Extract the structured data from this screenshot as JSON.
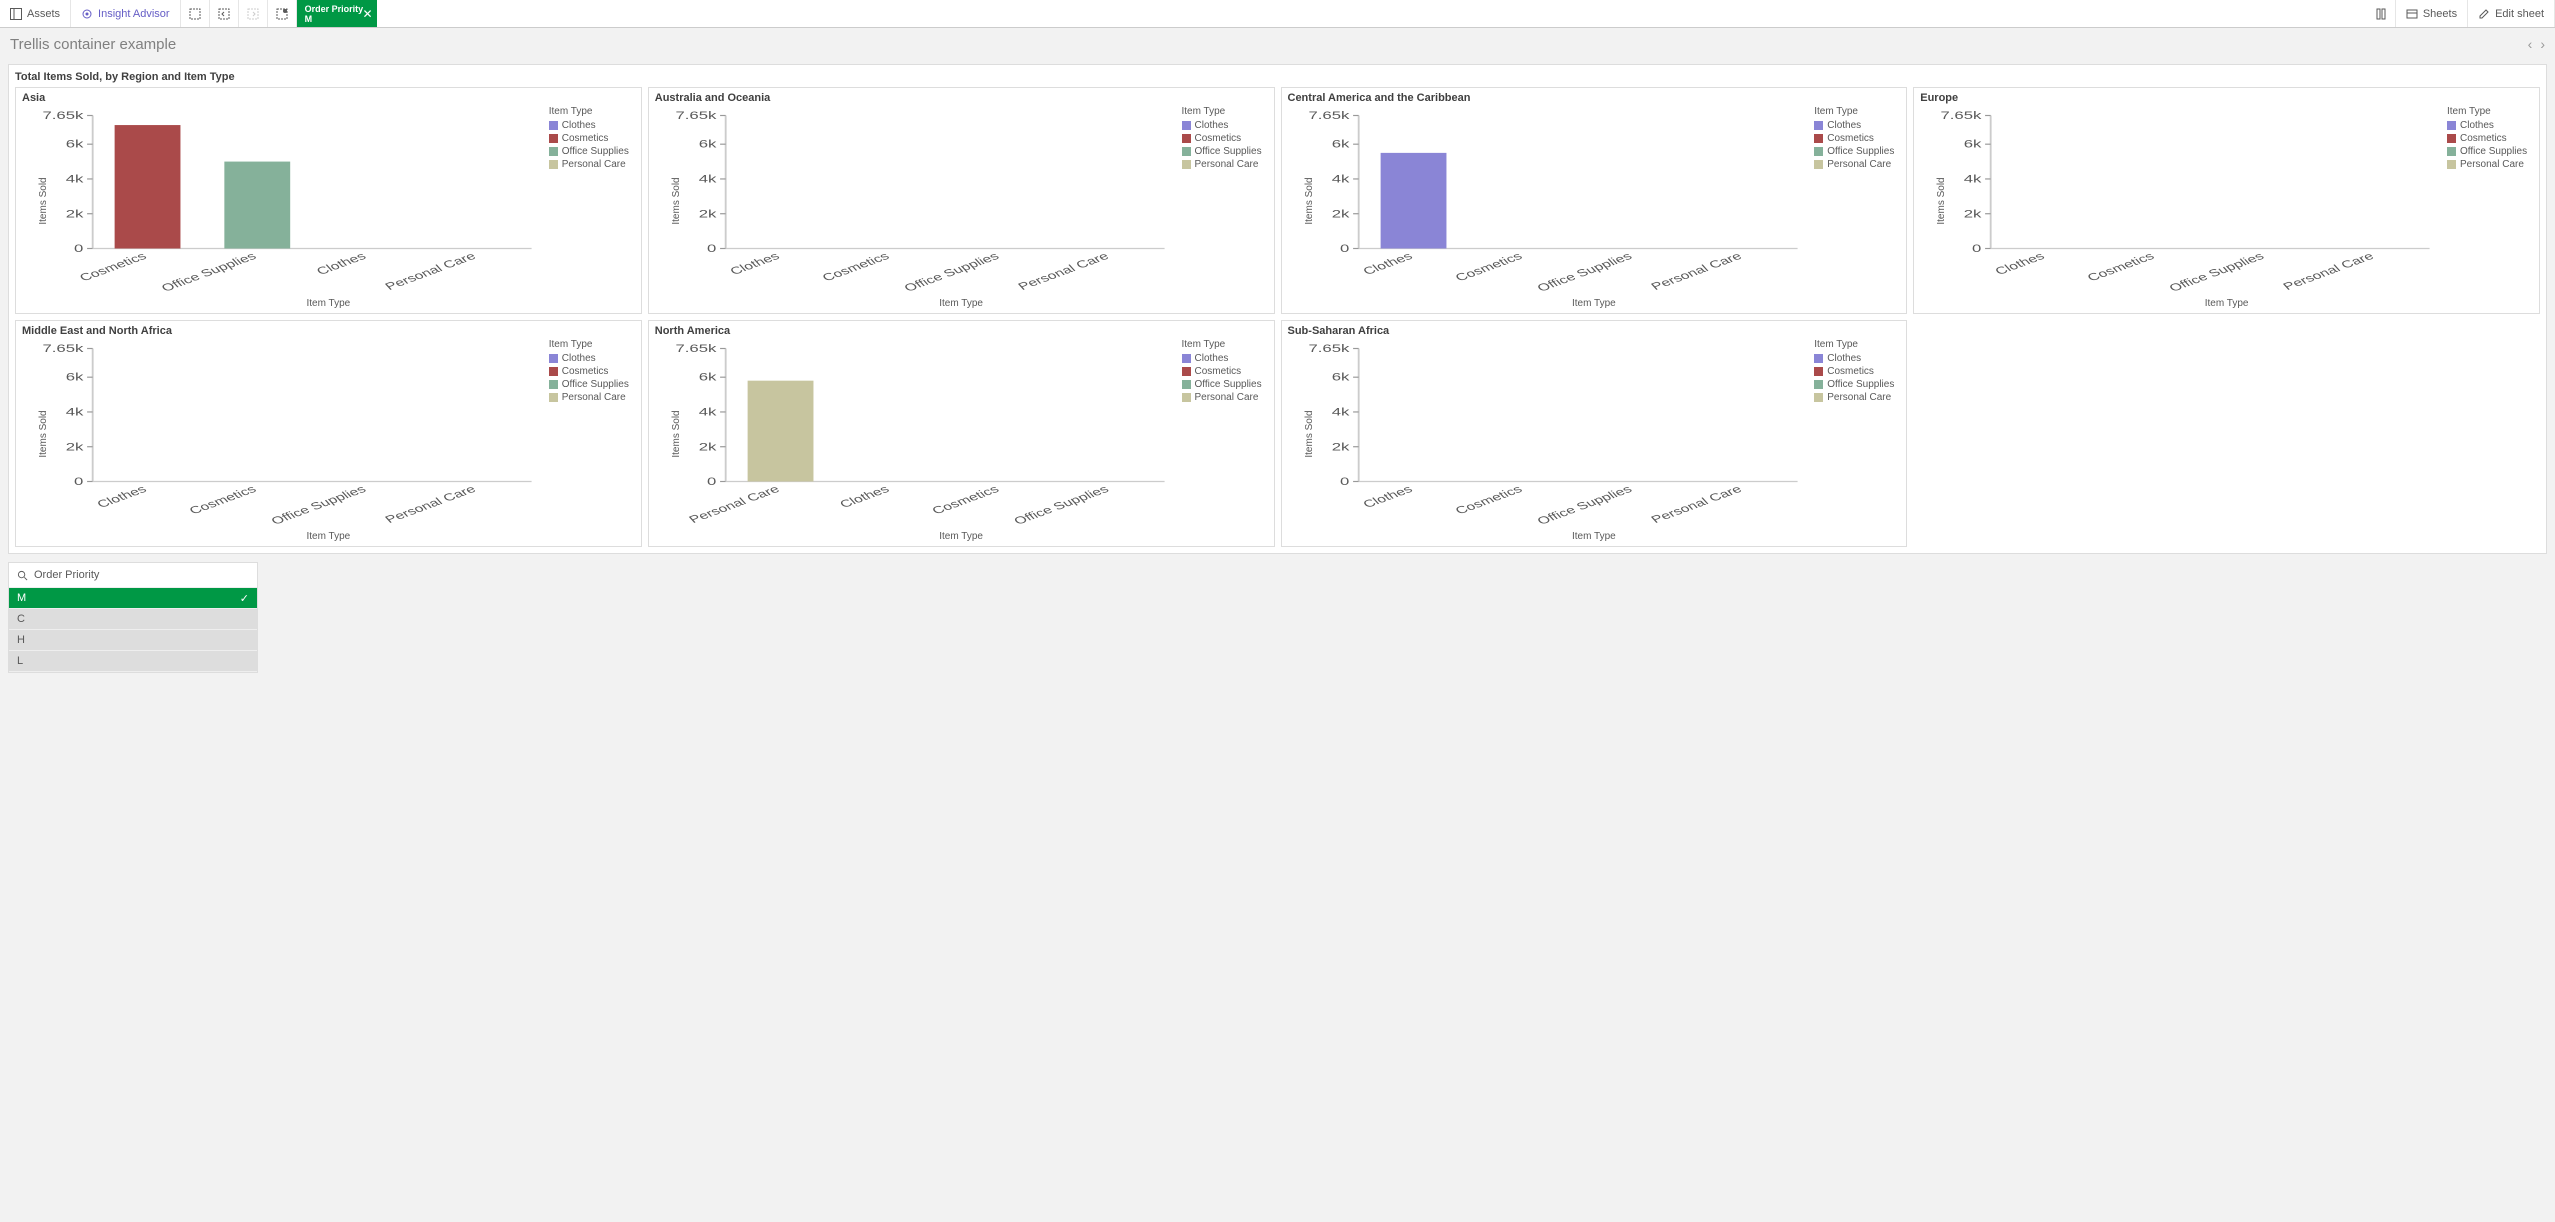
{
  "toolbar": {
    "assets": "Assets",
    "insight": "Insight Advisor",
    "sheets": "Sheets",
    "edit": "Edit sheet",
    "selection": {
      "field": "Order Priority",
      "value": "M"
    }
  },
  "title": "Trellis container example",
  "trellis": {
    "title": "Total Items Sold, by Region and Item Type"
  },
  "axis": {
    "xlabel": "Item Type",
    "ylabel": "Items Sold"
  },
  "legend": {
    "title": "Item Type",
    "items": [
      "Clothes",
      "Cosmetics",
      "Office Supplies",
      "Personal Care"
    ]
  },
  "colors": {
    "Clothes": "#8a85d6",
    "Cosmetics": "#aa4a4a",
    "Office Supplies": "#85b19a",
    "Personal Care": "#c7c59f"
  },
  "yticks": [
    0,
    2000,
    4000,
    6000,
    7650
  ],
  "ytick_labels": [
    "0",
    "2k",
    "4k",
    "6k",
    "7.65k"
  ],
  "filter": {
    "field": "Order Priority",
    "options": [
      {
        "value": "M",
        "selected": true
      },
      {
        "value": "C",
        "selected": false
      },
      {
        "value": "H",
        "selected": false
      },
      {
        "value": "L",
        "selected": false
      }
    ]
  },
  "chart_data": [
    {
      "title": "Asia",
      "type": "bar",
      "categories": [
        "Cosmetics",
        "Office Supplies",
        "Clothes",
        "Personal Care"
      ],
      "values": [
        7100,
        5000,
        0,
        0
      ],
      "ylabel": "Items Sold",
      "xlabel": "Item Type",
      "ylim": [
        0,
        7650
      ]
    },
    {
      "title": "Australia and Oceania",
      "type": "bar",
      "categories": [
        "Clothes",
        "Cosmetics",
        "Office Supplies",
        "Personal Care"
      ],
      "values": [
        0,
        0,
        0,
        0
      ],
      "ylabel": "Items Sold",
      "xlabel": "Item Type",
      "ylim": [
        0,
        7650
      ]
    },
    {
      "title": "Central America and the Caribbean",
      "type": "bar",
      "categories": [
        "Clothes",
        "Cosmetics",
        "Office Supplies",
        "Personal Care"
      ],
      "values": [
        5500,
        0,
        0,
        0
      ],
      "ylabel": "Items Sold",
      "xlabel": "Item Type",
      "ylim": [
        0,
        7650
      ]
    },
    {
      "title": "Europe",
      "type": "bar",
      "categories": [
        "Clothes",
        "Cosmetics",
        "Office Supplies",
        "Personal Care"
      ],
      "values": [
        0,
        0,
        0,
        0
      ],
      "ylabel": "Items Sold",
      "xlabel": "Item Type",
      "ylim": [
        0,
        7650
      ]
    },
    {
      "title": "Middle East and North Africa",
      "type": "bar",
      "categories": [
        "Clothes",
        "Cosmetics",
        "Office Supplies",
        "Personal Care"
      ],
      "values": [
        0,
        0,
        0,
        0
      ],
      "ylabel": "Items Sold",
      "xlabel": "Item Type",
      "ylim": [
        0,
        7650
      ]
    },
    {
      "title": "North America",
      "type": "bar",
      "categories": [
        "Personal Care",
        "Clothes",
        "Cosmetics",
        "Office Supplies"
      ],
      "values": [
        5800,
        0,
        0,
        0
      ],
      "ylabel": "Items Sold",
      "xlabel": "Item Type",
      "ylim": [
        0,
        7650
      ]
    },
    {
      "title": "Sub-Saharan Africa",
      "type": "bar",
      "categories": [
        "Clothes",
        "Cosmetics",
        "Office Supplies",
        "Personal Care"
      ],
      "values": [
        0,
        0,
        0,
        0
      ],
      "ylabel": "Items Sold",
      "xlabel": "Item Type",
      "ylim": [
        0,
        7650
      ]
    }
  ]
}
